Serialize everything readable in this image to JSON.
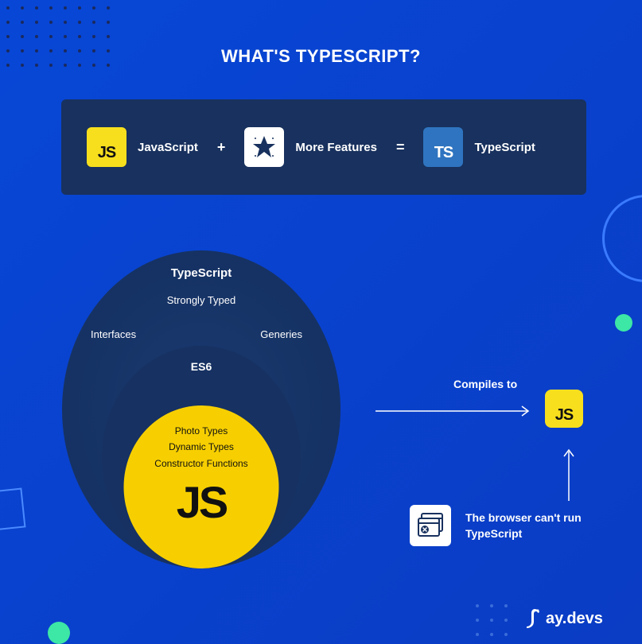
{
  "title": "WHAT'S TYPESCRIPT?",
  "equation": {
    "js_icon": "JS",
    "js_label": "JavaScript",
    "plus": "+",
    "features_label": "More Features",
    "equals": "=",
    "ts_icon": "TS",
    "ts_label": "TypeScript"
  },
  "venn": {
    "outer_title": "TypeScript",
    "outer_sub": "Strongly Typed",
    "outer_left": "Interfaces",
    "outer_right": "Generies",
    "mid_title": "ES6",
    "inner_line1": "Photo Types",
    "inner_line2": "Dynamic Types",
    "inner_line3": "Constructor Functions",
    "inner_big": "JS"
  },
  "right": {
    "compiles_to": "Compiles to",
    "js_icon": "JS",
    "browser_msg": "The browser can't run TypeScript"
  },
  "brand": "ay.devs"
}
